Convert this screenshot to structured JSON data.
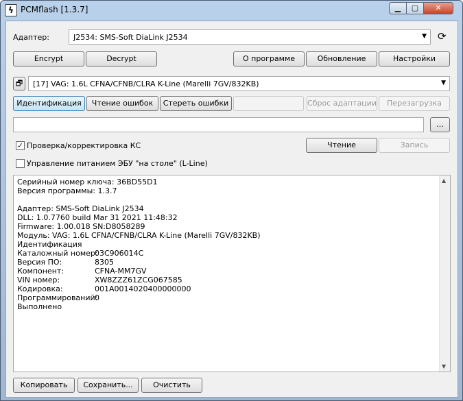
{
  "window": {
    "title": "PCMflash [1.3.7]",
    "app_icon": "bolt-icon"
  },
  "adapter": {
    "label": "Адаптер:",
    "selected": "J2534: SMS-Soft DiaLink J2534"
  },
  "top_buttons": {
    "encrypt": "Encrypt",
    "decrypt": "Decrypt",
    "about": "О программе",
    "update": "Обновление",
    "settings": "Настройки"
  },
  "module": {
    "selected": "[17] VAG: 1.6L CFNA/CFNB/CLRA K-Line (Marelli 7GV/832KB)"
  },
  "actions": {
    "identify": "Идентификация",
    "read_errors": "Чтение ошибок",
    "clear_errors": "Стереть ошибки",
    "blank": "",
    "reset_adapt": "Сброс адаптации",
    "reboot": "Перезагрузка"
  },
  "file": {
    "path": "",
    "browse": "..."
  },
  "checksum": {
    "label": "Проверка/корректировка КС",
    "checked": true
  },
  "read_write": {
    "read": "Чтение",
    "write": "Запись"
  },
  "power": {
    "label": "Управление питанием ЭБУ \"на столе\" (L-Line)",
    "checked": false
  },
  "log": {
    "lines": [
      "Серийный номер ключа: 36BD55D1",
      "Версия программы: 1.3.7",
      "",
      "Адаптер: SMS-Soft DiaLink J2534",
      "DLL: 1.0.7760 build Mar 31 2021 11:48:32",
      "Firmware: 1.00.018 SN:D8058289",
      "Модуль: VAG: 1.6L CFNA/CFNB/CLRA K-Line (Marelli 7GV/832KB)",
      "Идентификация"
    ],
    "kv": [
      {
        "key": "Каталожный номер:",
        "value": "03C906014C"
      },
      {
        "key": "Версия ПО:",
        "value": "8305"
      },
      {
        "key": "Компонент:",
        "value": "CFNA-MM7GV"
      },
      {
        "key": "VIN номер:",
        "value": "XW8ZZZ61ZCG067585"
      },
      {
        "key": "Кодировка:",
        "value": "001A0014020400000000"
      },
      {
        "key": "Программирований:",
        "value": "0"
      }
    ],
    "done": "Выполнено"
  },
  "bottom_buttons": {
    "copy": "Копировать",
    "save": "Сохранить...",
    "clear": "Очистить"
  }
}
